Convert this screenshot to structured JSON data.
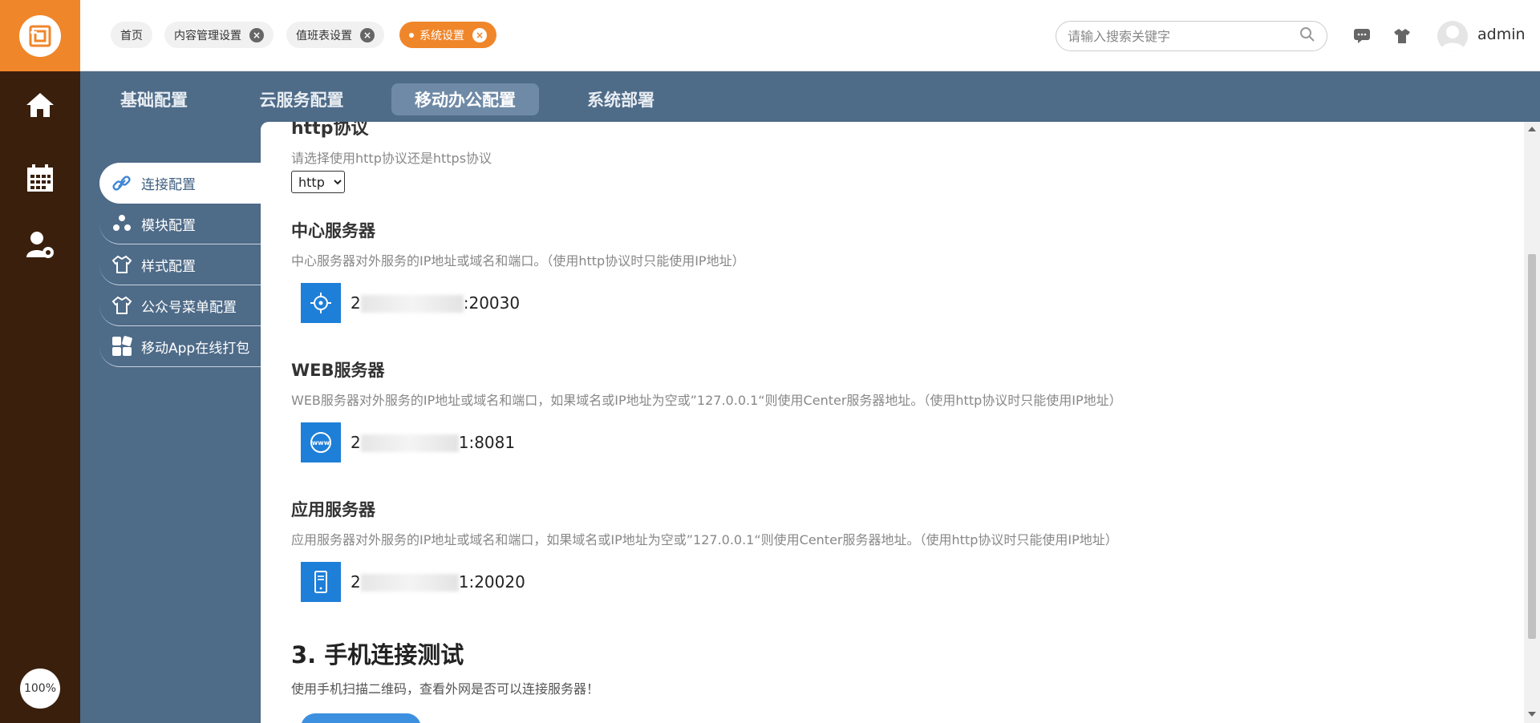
{
  "app": {
    "zoom": "100%"
  },
  "topbar": {
    "tabs": [
      {
        "label": "首页",
        "closable": false,
        "active": false
      },
      {
        "label": "内容管理设置",
        "closable": true,
        "active": false
      },
      {
        "label": "值班表设置",
        "closable": true,
        "active": false
      },
      {
        "label": "系统设置",
        "closable": true,
        "active": true
      }
    ],
    "search_placeholder": "请输入搜索关键字",
    "username": "admin"
  },
  "section_tabs": [
    "基础配置",
    "云服务配置",
    "移动办公配置",
    "系统部署"
  ],
  "side_menu": [
    "连接配置",
    "模块配置",
    "样式配置",
    "公众号菜单配置",
    "移动App在线打包"
  ],
  "content": {
    "http": {
      "title": "http协议",
      "desc": "请选择使用http协议还是https协议",
      "selected": "http",
      "options": [
        "http"
      ]
    },
    "center": {
      "title": "中心服务器",
      "desc": "中心服务器对外服务的IP地址或域名和端口。（使用http协议时只能使用IP地址）",
      "addr_prefix": "2",
      "addr_suffix": ":20030"
    },
    "web": {
      "title": "WEB服务器",
      "desc": "WEB服务器对外服务的IP地址或域名和端口，如果域名或IP地址为空或”127.0.0.1“则使用Center服务器地址。（使用http协议时只能使用IP地址）",
      "addr_prefix": "2",
      "addr_suffix": "1:8081"
    },
    "app": {
      "title": "应用服务器",
      "desc": "应用服务器对外服务的IP地址或域名和端口，如果域名或IP地址为空或”127.0.0.1“则使用Center服务器地址。（使用http协议时只能使用IP地址）",
      "addr_prefix": "2",
      "addr_suffix": "1:20020"
    },
    "phone_test": {
      "title": "3. 手机连接测试",
      "desc": "使用手机扫描二维码，查看外网是否可以连接服务器！"
    }
  },
  "colors": {
    "accent": "#f0862a",
    "rail": "#3a1f0d",
    "nav_bg": "#4e6b88",
    "icon_blue": "#1e7fd8"
  }
}
